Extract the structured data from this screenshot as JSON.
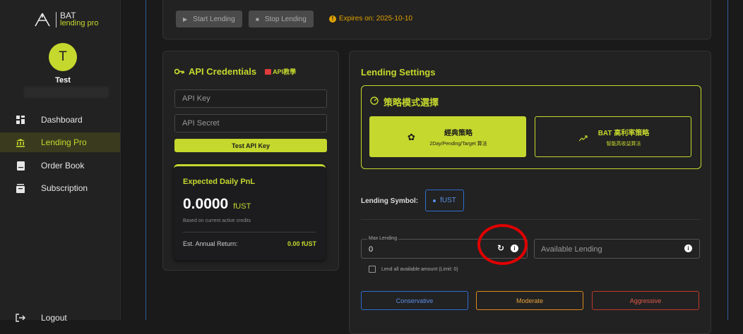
{
  "brand": {
    "name": "BAT",
    "subtitle": "lending pro"
  },
  "user": {
    "initial": "T",
    "name": "Test"
  },
  "sidebar": {
    "items": [
      {
        "label": "Dashboard",
        "icon": "dashboard-icon"
      },
      {
        "label": "Lending Pro",
        "icon": "bank-icon"
      },
      {
        "label": "Order Book",
        "icon": "book-icon"
      },
      {
        "label": "Subscription",
        "icon": "subscription-icon"
      }
    ],
    "logout": "Logout"
  },
  "toolbar": {
    "start_label": "Start Lending",
    "stop_label": "Stop Lending",
    "expires": "Expires on: 2025-10-10"
  },
  "api": {
    "title": "API Credentials",
    "tutorial": "API教學",
    "key_placeholder": "API Key",
    "secret_placeholder": "API Secret",
    "test_button": "Test API Key"
  },
  "pnl": {
    "title": "Expected Daily PnL",
    "value": "0.0000",
    "unit": "fUST",
    "note": "Based on current active credits",
    "annual_label": "Est. Annual Return:",
    "annual_value": "0.00 fUST"
  },
  "lending": {
    "title": "Lending Settings",
    "strategy_title": "策略模式選擇",
    "classic_title": "經典策略",
    "classic_sub": "2Day/Pending/Target 算法",
    "high_title": "BAT 高利率策略",
    "high_sub": "智能高收益算法",
    "symbol_label": "Lending Symbol:",
    "symbol_value": "fUST",
    "max_label": "Max Lending",
    "max_value": "0",
    "available_placeholder": "Available Lending",
    "lend_all_label": "Lend all available amount (Limit: 0)",
    "risk": [
      "Conservative",
      "Moderate",
      "Aggressive"
    ]
  },
  "colors": {
    "accent": "#c5d82e",
    "warning": "#e0a100",
    "blue": "#2e6dd1",
    "orange": "#e08a1e",
    "red": "#c0392b",
    "annotation": "#e00000"
  }
}
